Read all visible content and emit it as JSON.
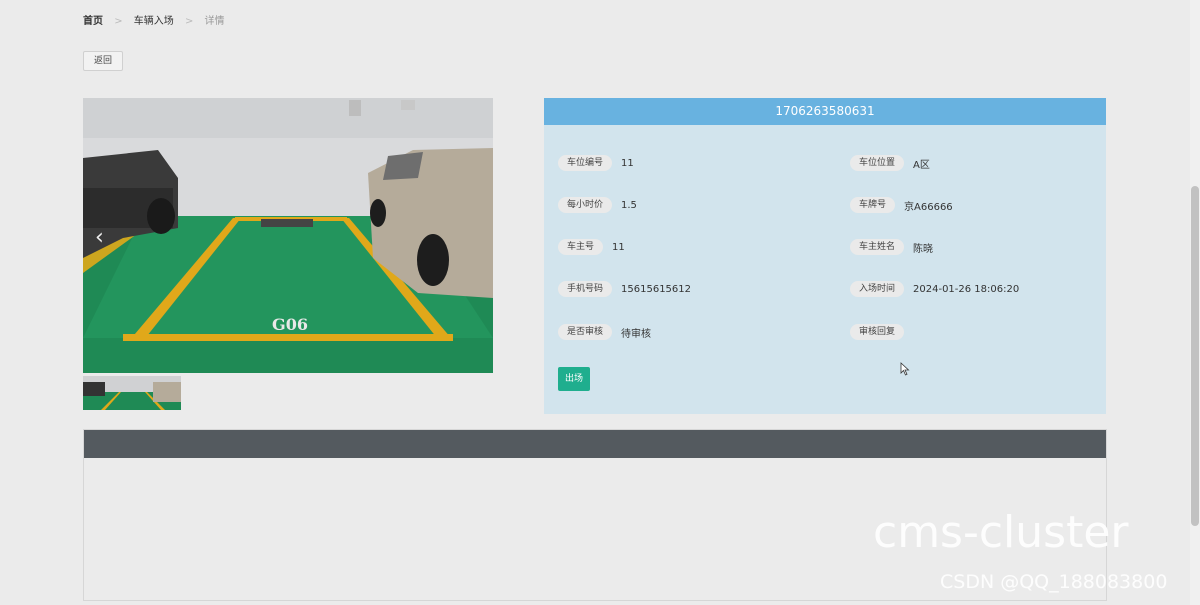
{
  "breadcrumb": {
    "items": [
      "首页",
      "车辆入场",
      "详情"
    ],
    "separator": ">"
  },
  "back_label": "返回",
  "detail": {
    "title": "1706263580631",
    "fields": [
      {
        "label": "车位编号",
        "value": "11"
      },
      {
        "label": "车位位置",
        "value": "A区"
      },
      {
        "label": "每小时价",
        "value": "1.5"
      },
      {
        "label": "车牌号",
        "value": "京A66666"
      },
      {
        "label": "车主号",
        "value": "11"
      },
      {
        "label": "车主姓名",
        "value": "陈晓"
      },
      {
        "label": "手机号码",
        "value": "15615615612"
      },
      {
        "label": "入场时间",
        "value": "2024-01-26 18:06:20"
      },
      {
        "label": "是否审核",
        "value": "待审核"
      },
      {
        "label": "审核回复",
        "value": ""
      }
    ],
    "exit_label": "出场"
  },
  "image": {
    "spot_code": "G06",
    "prev_arrow": "‹"
  },
  "watermark": {
    "text": "cms-cluster",
    "csdn": "CSDN @QQ_188083800"
  },
  "colors": {
    "panel_header": "#68b2e0",
    "panel_bg": "#d2e4ed",
    "exit_button": "#1fae8e",
    "lower_header": "#545a5f"
  }
}
